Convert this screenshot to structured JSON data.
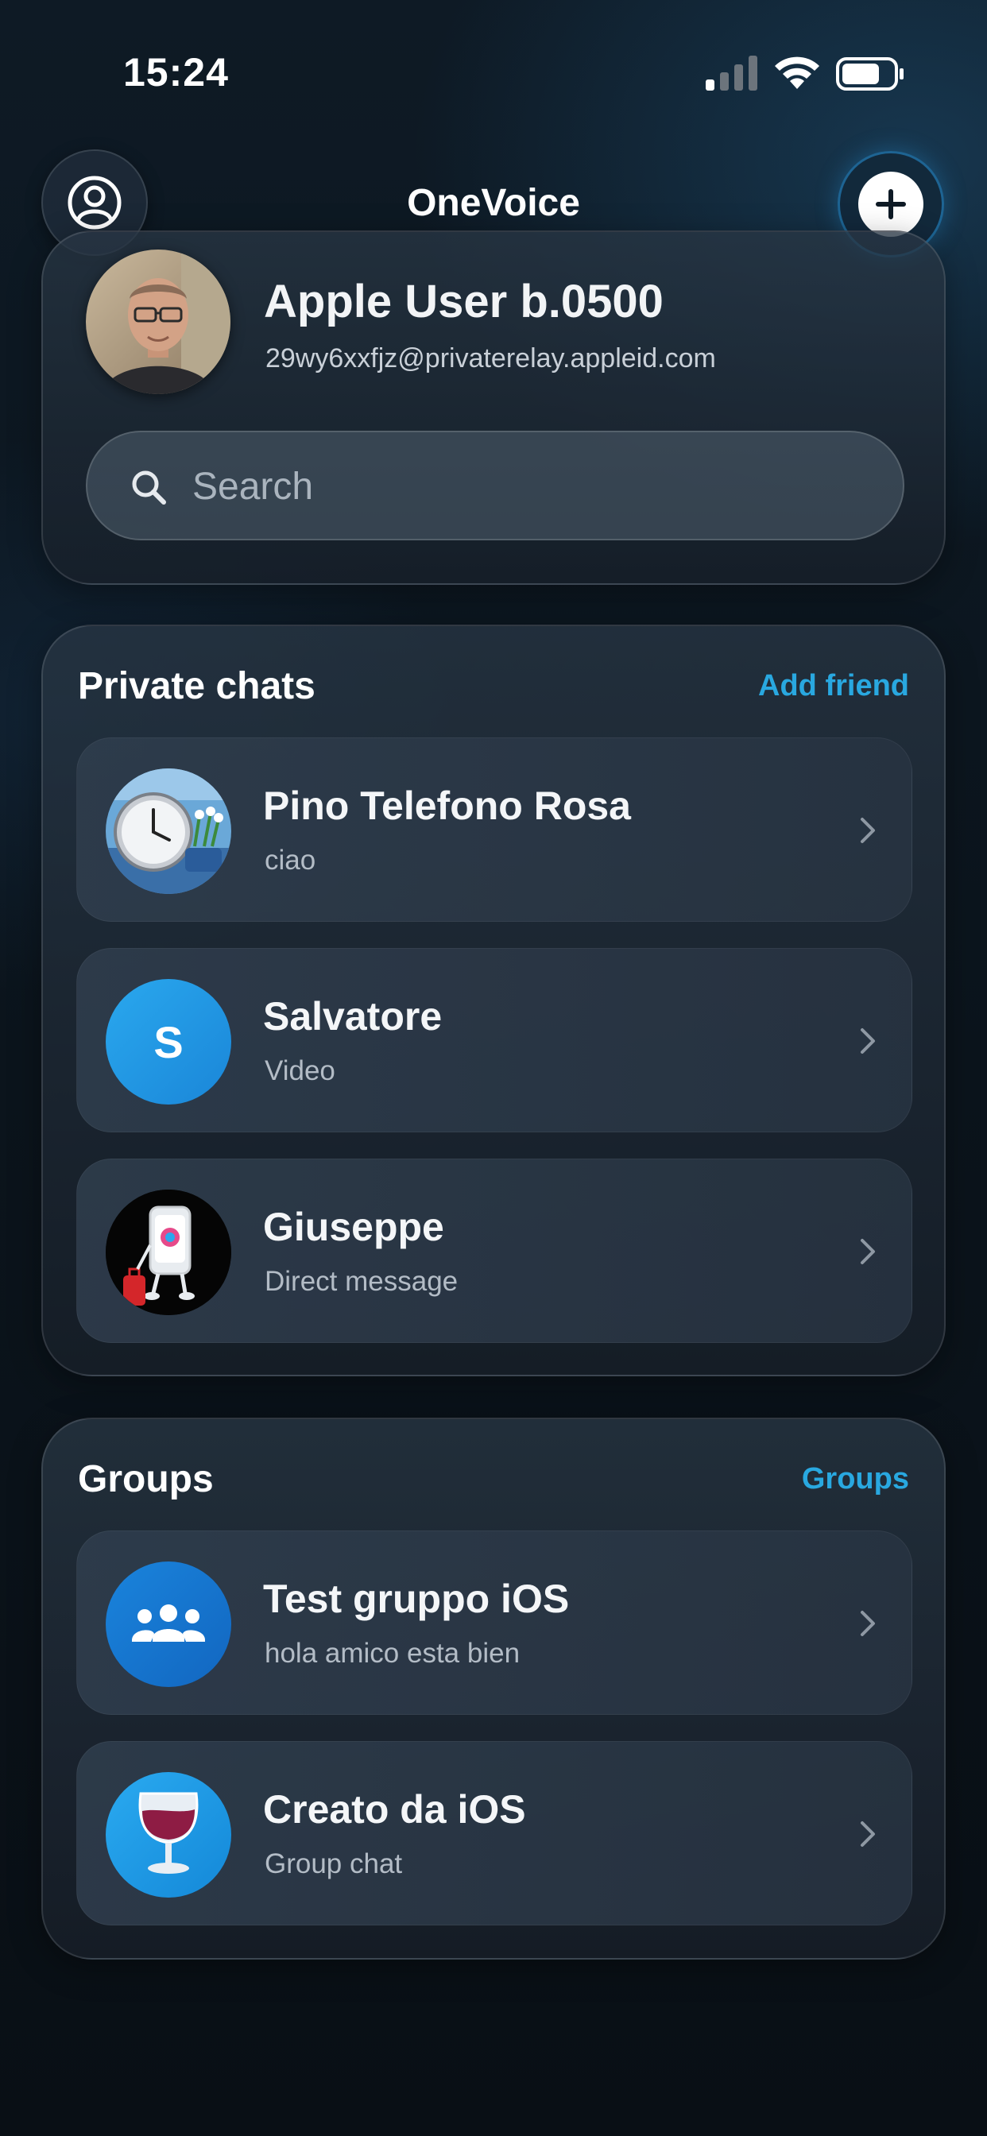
{
  "status_bar": {
    "time": "15:24"
  },
  "header": {
    "title": "OneVoice"
  },
  "profile": {
    "name": "Apple User b.0500",
    "email": "29wy6xxfjz@privaterelay.appleid.com"
  },
  "search": {
    "placeholder": "Search",
    "value": ""
  },
  "private_chats": {
    "title": "Private chats",
    "action": "Add friend",
    "items": [
      {
        "name": "Pino Telefono Rosa",
        "subtitle": "ciao"
      },
      {
        "name": "Salvatore",
        "subtitle": "Video",
        "initial": "S"
      },
      {
        "name": "Giuseppe",
        "subtitle": "Direct message"
      }
    ]
  },
  "groups": {
    "title": "Groups",
    "action": "Groups",
    "items": [
      {
        "name": "Test gruppo iOS",
        "subtitle": "hola amico esta bien"
      },
      {
        "name": "Creato da iOS",
        "subtitle": "Group chat"
      }
    ]
  },
  "colors": {
    "accent": "#29a8e0",
    "salvatore_avatar": "#1e9be6",
    "group_avatar": "#1476d2",
    "wine_avatar": "#1a9ce6"
  },
  "icons": {
    "profile_button": "person-circle-icon",
    "add_button": "plus-icon",
    "search": "magnifier-icon",
    "row_arrow": "chevron-right-icon",
    "group": "people-group-icon",
    "wine": "wine-glass-icon"
  }
}
